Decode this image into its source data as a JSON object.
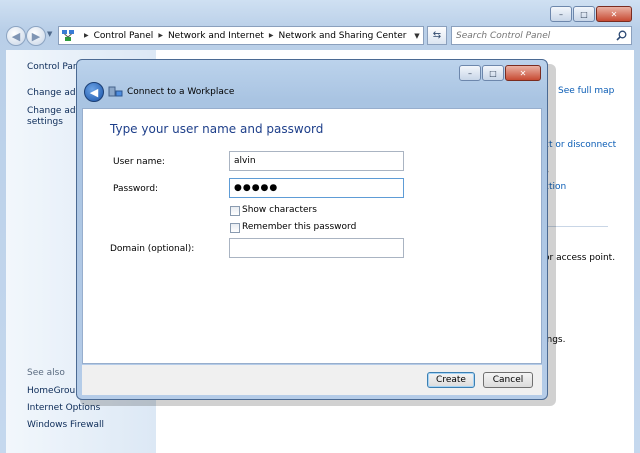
{
  "window": {
    "buttons": {
      "minimize": "–",
      "maximize": "□",
      "close": "✕"
    }
  },
  "address_bar": {
    "breadcrumbs": [
      "Control Panel",
      "Network and Internet",
      "Network and Sharing Center"
    ]
  },
  "search": {
    "placeholder": "Search Control Panel"
  },
  "left_pane": {
    "links": [
      "Control Panel",
      "Change adap",
      "Change adva",
      "settings"
    ],
    "see_also_label": "See also",
    "see_also": [
      "HomeGroup",
      "Internet Options",
      "Windows Firewall"
    ]
  },
  "background": {
    "see_full_map": "See full map",
    "connect_or_disconnect": "ct or disconnect",
    "fragment_s": "s",
    "fragment_ction": "ction",
    "access_point": "or access point.",
    "ings": "ings."
  },
  "dialog": {
    "title": "Connect to a Workplace",
    "heading": "Type your user name and password",
    "username_label": "User name:",
    "username_value": "alvin",
    "password_label": "Password:",
    "password_value": "●●●●●",
    "show_characters_label": "Show characters",
    "show_characters_checked": false,
    "remember_password_label": "Remember this password",
    "remember_password_checked": false,
    "domain_label": "Domain (optional):",
    "domain_value": "",
    "create_button": "Create",
    "cancel_button": "Cancel"
  },
  "colors": {
    "heading": "#1e3f8a",
    "link": "#0b5db5",
    "title_bar": "#b9cfe8"
  }
}
